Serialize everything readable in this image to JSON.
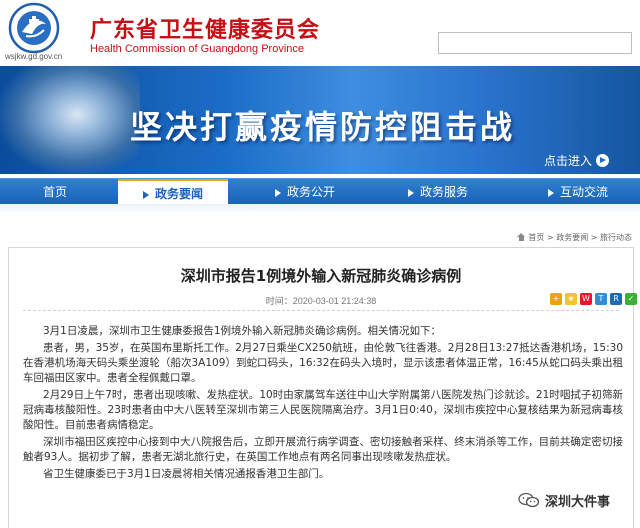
{
  "header": {
    "title_cn": "广东省卫生健康委员会",
    "title_en": "Health Commission of Guangdong Province",
    "logo_url": "wsjkw.gd.gov.cn",
    "search_placeholder": "",
    "accent_color": "#c40f15"
  },
  "banner": {
    "slogan": "坚决打赢疫情防控阻击战",
    "enter_label": "点击进入"
  },
  "nav": {
    "items": [
      {
        "label": "首页",
        "active": false
      },
      {
        "label": "政务要闻",
        "active": true
      },
      {
        "label": "政务公开",
        "active": false
      },
      {
        "label": "政务服务",
        "active": false
      },
      {
        "label": "互动交流",
        "active": false
      }
    ],
    "bar_color": "#1a63b8"
  },
  "breadcrumb": {
    "items": [
      "首页",
      "政务要闻",
      "旅行动态"
    ],
    "separator": " > "
  },
  "article": {
    "title": "深圳市报告1例境外输入新冠肺炎确诊病例",
    "publish_time": "时间：2020-03-01 21:24:38",
    "paragraphs": [
      "3月1日凌晨，深圳市卫生健康委报告1例境外输入新冠肺炎确诊病例。相关情况如下：",
      "患者，男，35岁，在英国布里斯托工作。2月27日乘坐CX250航班，由伦敦飞往香港。2月28日13:27抵达香港机场，15:30在香港机场海天码头乘坐渡轮（船次3A109）到蛇口码头，16:32在码头入境时，显示该患者体温正常，16:45从蛇口码头乘出租车回福田区家中。患者全程佩戴口罩。",
      "2月29日上午7时，患者出现咳嗽、发热症状。10时由家属驾车送往中山大学附属第八医院发热门诊就诊。21时咽拭子初筛新冠病毒核酸阳性。23时患者由中大八医转至深圳市第三人民医院隔离治疗。3月1日0:40，深圳市疾控中心复核结果为新冠病毒核酸阳性。目前患者病情稳定。",
      "深圳市福田区疾控中心接到中大八院报告后，立即开展流行病学调查、密切接触者采样、终末消杀等工作，目前共确定密切接触者93人。据初步了解，患者无湖北旅行史，在英国工作地点有两名同事出现咳嗽发热症状。",
      "省卫生健康委已于3月1日凌晨将相关情况通报香港卫生部门。"
    ],
    "share_icons": [
      "add-share-icon",
      "qzone-icon",
      "weibo-icon",
      "tencent-weibo-icon",
      "renren-icon",
      "wechat-share-icon"
    ]
  },
  "watermark": {
    "text": "深圳大件事"
  }
}
